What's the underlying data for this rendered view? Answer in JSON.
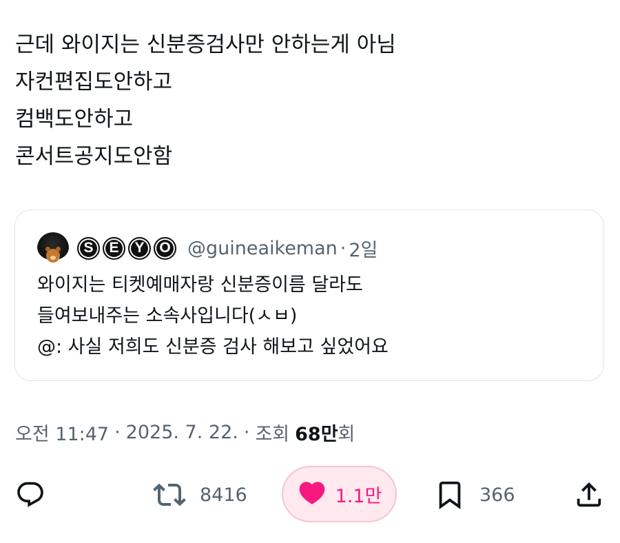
{
  "tweet": {
    "lines": [
      "근데 와이지는 신분증검사만 안하는게 아님",
      "자컨편집도안하고",
      "컴백도안하고",
      "콘서트공지도안함"
    ]
  },
  "quote": {
    "avatar_icon": "avatar-afro-bear",
    "badges": [
      "S",
      "E",
      "Y",
      "O"
    ],
    "handle": "@guineaikeman",
    "separator": "·",
    "time": "2일",
    "lines": [
      "와이지는 티켓예매자랑 신분증이름 달라도",
      "들여보내주는 소속사입니다(ㅅㅂ)",
      "@: 사실 저희도 신분증 검사 해보고 싶었어요"
    ]
  },
  "meta": {
    "time": "오전 11:47",
    "sep1": "·",
    "date": "2025. 7. 22.",
    "sep2": "·",
    "views_label": "조회",
    "views_number": "68만",
    "views_unit": "회"
  },
  "actions": {
    "reply": {
      "icon": "reply-icon",
      "count": ""
    },
    "retweet": {
      "icon": "retweet-icon",
      "count": "8416"
    },
    "like": {
      "icon": "heart-icon",
      "count": "1.1만",
      "active": true,
      "color": "#f91880"
    },
    "bookmark": {
      "icon": "bookmark-icon",
      "count": "366"
    },
    "share": {
      "icon": "share-icon"
    }
  },
  "colors": {
    "text": "#0f1419",
    "secondary": "#536471",
    "like_accent": "#f91880",
    "card_border": "#dfe3e7"
  }
}
